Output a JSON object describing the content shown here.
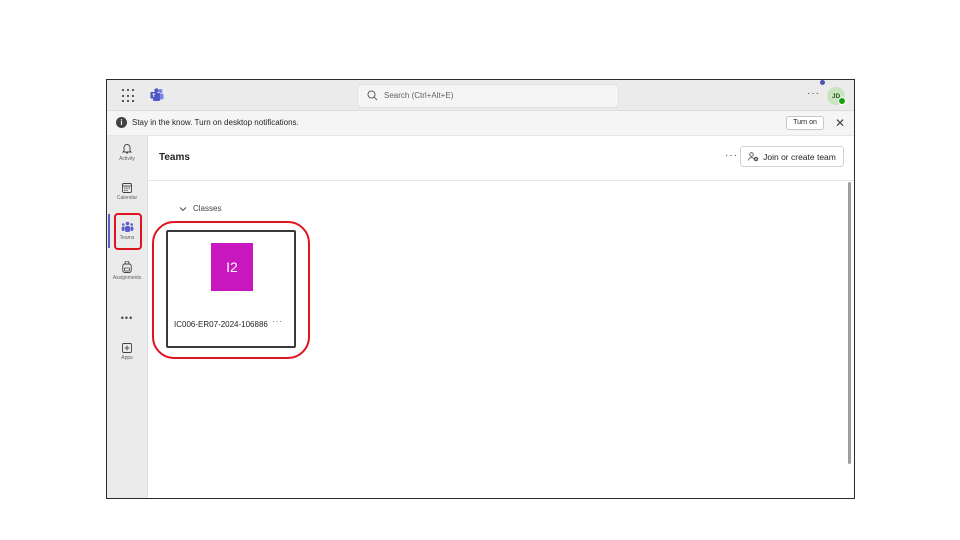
{
  "titlebar": {
    "search_placeholder": "Search (Ctrl+Alt+E)",
    "more_label": "···",
    "avatar_initials": "JD"
  },
  "notification": {
    "text": "Stay in the know. Turn on desktop notifications.",
    "info_symbol": "i",
    "turn_on_label": "Turn on",
    "close_label": "✕"
  },
  "rail": {
    "items": [
      {
        "label": "Activity",
        "icon": "bell-icon"
      },
      {
        "label": "Calendar",
        "icon": "calendar-icon"
      },
      {
        "label": "Teams",
        "icon": "teams-icon"
      },
      {
        "label": "Assignments",
        "icon": "backpack-icon"
      },
      {
        "label": "",
        "icon": "more-icon"
      },
      {
        "label": "Apps",
        "icon": "plus-square-icon"
      }
    ],
    "more_label": "•••"
  },
  "header": {
    "title": "Teams",
    "more_label": "···",
    "join_label": "Join or create team"
  },
  "section": {
    "label": "Classes"
  },
  "teams": [
    {
      "initials": "I2",
      "name": "IC006-ER07-2024-106886",
      "more_label": "···",
      "color": "#c917bf"
    }
  ],
  "colors": {
    "highlight": "#e0141e",
    "accent": "#5b5fc7",
    "team_tile": "#c917bf"
  }
}
